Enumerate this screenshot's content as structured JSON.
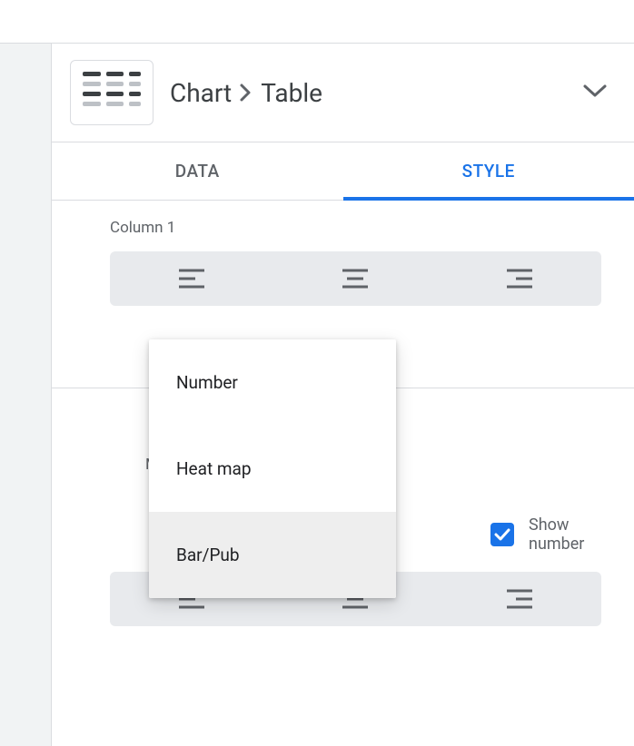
{
  "breadcrumb": {
    "root": "Chart",
    "leaf": "Table"
  },
  "tabs": {
    "data": "DATA",
    "style": "STYLE"
  },
  "column": {
    "label": "Column 1"
  },
  "metric": {
    "label_partial": "M",
    "show_number": "Show number"
  },
  "dropdown": {
    "options": {
      "number": "Number",
      "heatmap": "Heat map",
      "barpub": "Bar/Pub"
    }
  }
}
